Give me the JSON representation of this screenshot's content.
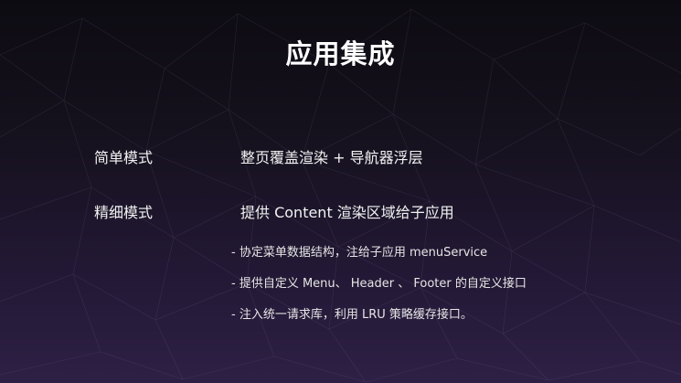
{
  "title": "应用集成",
  "modes": [
    {
      "label": "简单模式",
      "description": "整页覆盖渲染 + 导航器浮层"
    },
    {
      "label": "精细模式",
      "description": "提供 Content 渲染区域给子应用"
    }
  ],
  "details": [
    "- 协定菜单数据结构，注给子应用 menuService",
    "- 提供自定义 Menu、 Header 、 Footer 的自定义接口",
    "- 注入统一请求库，利用 LRU 策略缓存接口。"
  ],
  "colors": {
    "background_top": "#0d0b12",
    "background_bottom": "#2e2045",
    "text": "#ffffff"
  }
}
